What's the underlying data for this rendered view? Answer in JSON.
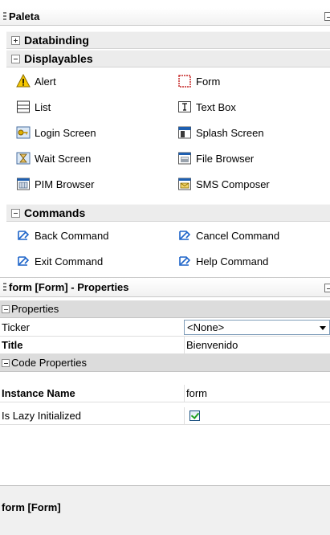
{
  "palette": {
    "title": "Paleta",
    "categories": {
      "databinding": "Databinding",
      "displayables": "Displayables",
      "commands": "Commands"
    },
    "displayables": {
      "alert": "Alert",
      "form": "Form",
      "list": "List",
      "text_box": "Text Box",
      "login_screen": "Login Screen",
      "splash_screen": "Splash Screen",
      "wait_screen": "Wait Screen",
      "file_browser": "File Browser",
      "pim_browser": "PIM Browser",
      "sms_composer": "SMS Composer"
    },
    "commands": {
      "back": "Back Command",
      "cancel": "Cancel Command",
      "exit": "Exit Command",
      "help": "Help Command"
    }
  },
  "properties": {
    "title": "form [Form] - Properties",
    "sections": {
      "properties": "Properties",
      "code_properties": "Code Properties"
    },
    "rows": {
      "ticker": {
        "name": "Ticker",
        "value": "<None>"
      },
      "title": {
        "name": "Title",
        "value": "Bienvenido"
      },
      "instance_name": {
        "name": "Instance Name",
        "value": "form"
      },
      "is_lazy": {
        "name": "Is Lazy Initialized",
        "checked": true
      }
    },
    "description_title": "form [Form]"
  }
}
